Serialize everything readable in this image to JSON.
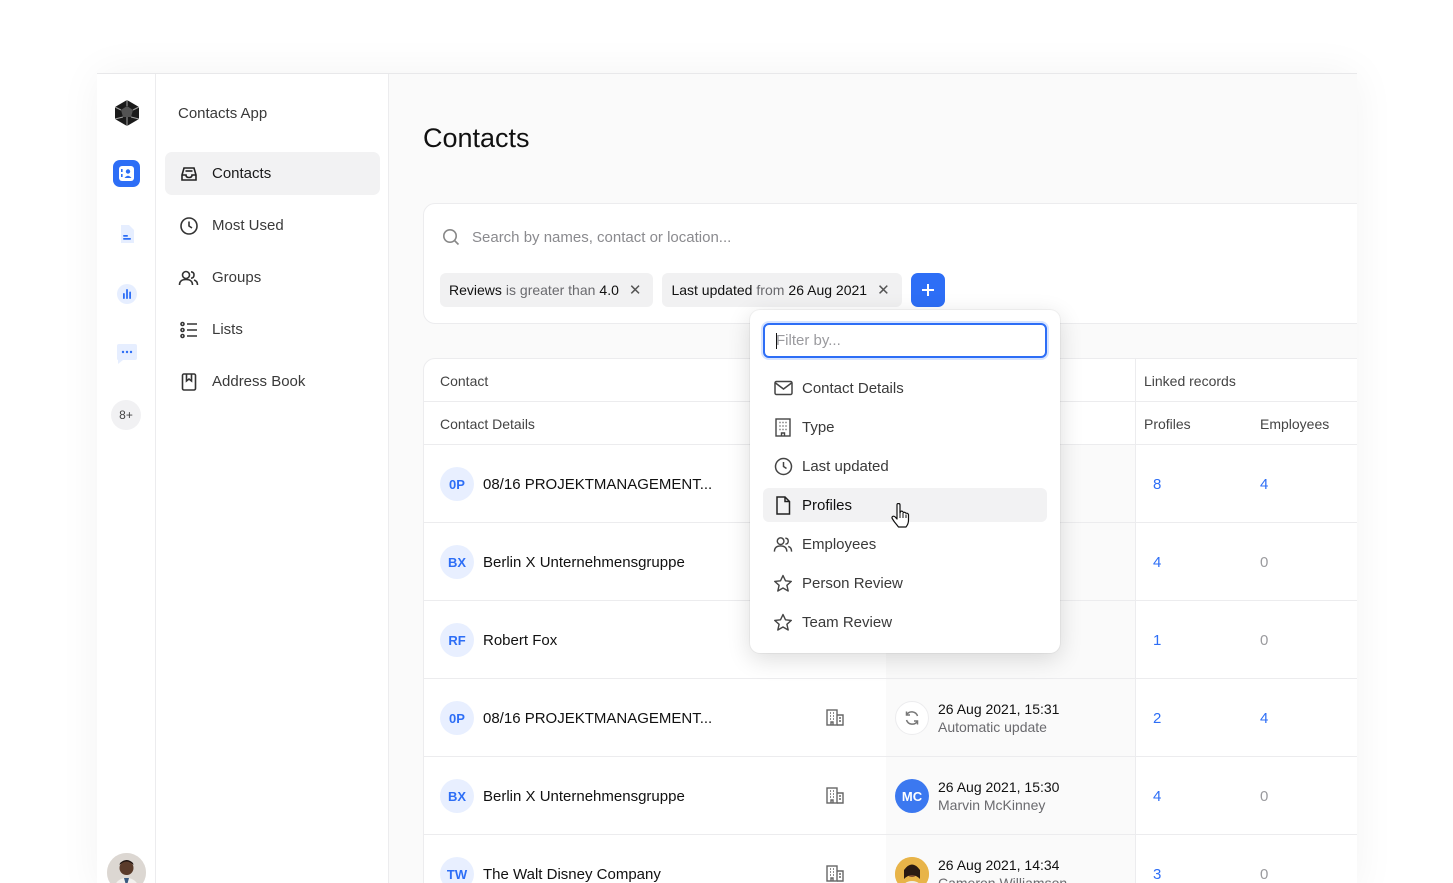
{
  "app": {
    "title": "Contacts App"
  },
  "rail": {
    "badge": "8+"
  },
  "nav": {
    "items": [
      {
        "label": "Contacts",
        "icon": "inbox-icon",
        "active": true
      },
      {
        "label": "Most Used",
        "icon": "clock-icon"
      },
      {
        "label": "Groups",
        "icon": "users-icon"
      },
      {
        "label": "Lists",
        "icon": "list-icon"
      },
      {
        "label": "Address Book",
        "icon": "bookmark-icon"
      }
    ]
  },
  "page": {
    "title": "Contacts"
  },
  "search": {
    "placeholder": "Search by names, contact or location..."
  },
  "filters": [
    {
      "key": "Reviews",
      "op": "is greater than",
      "value": "4.0"
    },
    {
      "key": "Last updated",
      "op": "from",
      "value": "26 Aug 2021"
    }
  ],
  "table": {
    "group_headers": {
      "contact": "Contact",
      "linked": "Linked records"
    },
    "columns": {
      "contact_details": "Contact Details",
      "profiles": "Profiles",
      "employees": "Employees"
    },
    "rows": [
      {
        "initials": "0P",
        "name": "08/16 PROJEKTMANAGEMENT...",
        "profiles": "8",
        "employees": "4"
      },
      {
        "initials": "BX",
        "name": "Berlin X Unternehmensgruppe",
        "profiles": "4",
        "employees": "0"
      },
      {
        "initials": "RF",
        "name": "Robert Fox",
        "profiles": "1",
        "employees": "0"
      },
      {
        "initials": "0P",
        "name": "08/16 PROJEKTMANAGEMENT...",
        "updated": "26 Aug 2021, 15:31",
        "updated_by": "Automatic update",
        "profiles": "2",
        "employees": "4"
      },
      {
        "initials": "BX",
        "name": "Berlin X Unternehmensgruppe",
        "updated": "26 Aug 2021, 15:30",
        "updated_by": "Marvin McKinney",
        "updater_initials": "MC",
        "profiles": "4",
        "employees": "0"
      },
      {
        "initials": "TW",
        "name": "The Walt Disney Company",
        "updated": "26 Aug 2021, 14:34",
        "updated_by": "Cameron Williamson",
        "profiles": "3",
        "employees": "0"
      }
    ]
  },
  "dropdown": {
    "placeholder": "Filter by...",
    "items": [
      {
        "label": "Contact Details",
        "icon": "mail-icon"
      },
      {
        "label": "Type",
        "icon": "building-icon"
      },
      {
        "label": "Last updated",
        "icon": "clock-icon"
      },
      {
        "label": "Profiles",
        "icon": "file-icon",
        "hover": true
      },
      {
        "label": "Employees",
        "icon": "users-icon"
      },
      {
        "label": "Person Review",
        "icon": "star-icon"
      },
      {
        "label": "Team Review",
        "icon": "star-icon"
      }
    ]
  },
  "colors": {
    "accent": "#2d6ef6",
    "link": "#2d6ef6"
  }
}
